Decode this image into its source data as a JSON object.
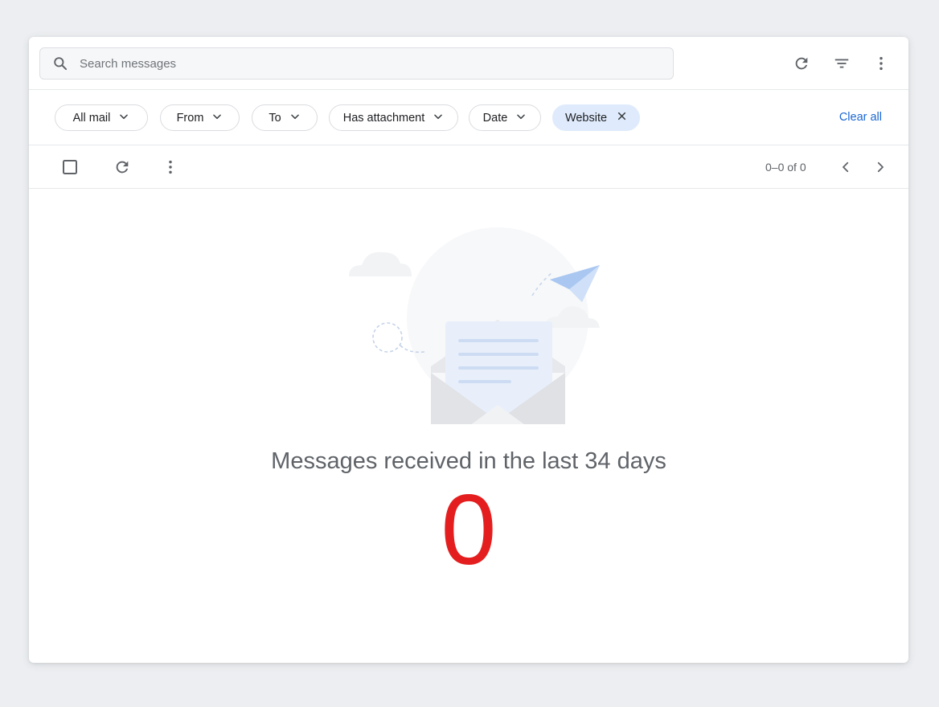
{
  "search": {
    "placeholder": "Search messages",
    "value": ""
  },
  "header_icons": [
    "refresh-icon",
    "filter-icon",
    "more-vert-icon"
  ],
  "filters": [
    {
      "label": "All mail",
      "has_dropdown": true
    },
    {
      "label": "From",
      "has_dropdown": true
    },
    {
      "label": "To",
      "has_dropdown": true
    },
    {
      "label": "Has attachment",
      "has_dropdown": true
    },
    {
      "label": "Date",
      "has_dropdown": true
    },
    {
      "label": "Website",
      "active": true,
      "removable": true
    }
  ],
  "clear_all_label": "Clear all",
  "toolbar": {
    "select_all_checked": false,
    "pagination": "0–0 of 0"
  },
  "empty_state": {
    "title": "Messages received in the last 34 days",
    "count": "0"
  },
  "colors": {
    "accent": "#1a67d2",
    "active_chip_bg": "#dfebfc",
    "count_color": "#e41e1e",
    "text_secondary": "#5f6368"
  }
}
